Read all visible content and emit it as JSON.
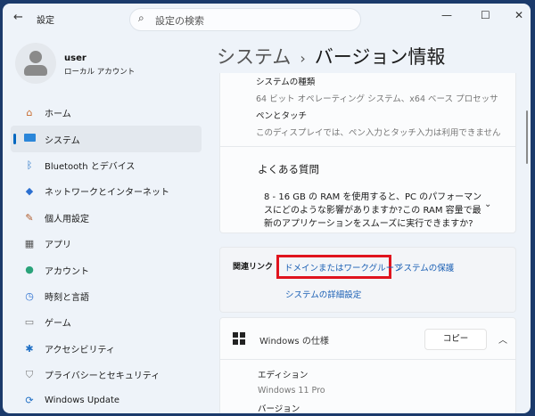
{
  "app": {
    "title": "設定",
    "search_placeholder": "設定の検索"
  },
  "user": {
    "name": "user",
    "type": "ローカル アカウント"
  },
  "nav": [
    {
      "label": "ホーム",
      "icon": "home-icon"
    },
    {
      "label": "システム",
      "icon": "system-icon",
      "selected": true
    },
    {
      "label": "Bluetooth とデバイス",
      "icon": "bluetooth-icon"
    },
    {
      "label": "ネットワークとインターネット",
      "icon": "wifi-icon"
    },
    {
      "label": "個人用設定",
      "icon": "brush-icon"
    },
    {
      "label": "アプリ",
      "icon": "apps-icon"
    },
    {
      "label": "アカウント",
      "icon": "account-icon"
    },
    {
      "label": "時刻と言語",
      "icon": "clock-globe-icon"
    },
    {
      "label": "ゲーム",
      "icon": "gamepad-icon"
    },
    {
      "label": "アクセシビリティ",
      "icon": "accessibility-icon"
    },
    {
      "label": "プライバシーとセキュリティ",
      "icon": "shield-icon"
    },
    {
      "label": "Windows Update",
      "icon": "update-icon"
    }
  ],
  "header": {
    "parent": "システム",
    "separator": "›",
    "title": "バージョン情報"
  },
  "specs": {
    "system_type_label": "システムの種類",
    "system_type_value": "64 ビット オペレーティング システム、x64 ベース プロセッサ",
    "pen_label": "ペンとタッチ",
    "pen_value": "このディスプレイでは、ペン入力とタッチ入力は利用できません"
  },
  "faq": {
    "title": "よくある質問",
    "question": "8 - 16 GB の RAM を使用すると、PC のパフォーマンスにどのような影響がありますか?この RAM 容量で最新のアプリケーションをスムーズに実行できますか?"
  },
  "related": {
    "label": "関連リンク",
    "links": [
      "ドメインまたはワークグループ",
      "システムの保護",
      "システムの詳細設定"
    ],
    "highlight_color": "#e0141e"
  },
  "windows_spec": {
    "title": "Windows の仕様",
    "copy_label": "コピー",
    "edition_label": "エディション",
    "edition_value": "Windows 11 Pro",
    "version_label": "バージョン"
  }
}
